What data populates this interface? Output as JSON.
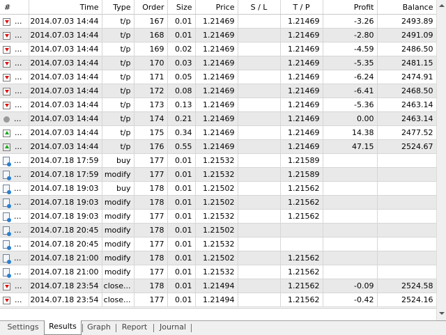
{
  "columns": {
    "hash": "#",
    "time": "Time",
    "type": "Type",
    "order": "Order",
    "size": "Size",
    "price": "Price",
    "sl": "S / L",
    "tp": "T / P",
    "profit": "Profit",
    "balance": "Balance"
  },
  "rows": [
    {
      "icon": "red-down-arrow-icon",
      "time": "2014.07.03 14:44",
      "type": "t/p",
      "order": "167",
      "size": "0.01",
      "price": "1.21469",
      "sl": "",
      "tp": "1.21469",
      "profit": "-3.26",
      "balance": "2493.89"
    },
    {
      "icon": "red-down-arrow-icon",
      "time": "2014.07.03 14:44",
      "type": "t/p",
      "order": "168",
      "size": "0.01",
      "price": "1.21469",
      "sl": "",
      "tp": "1.21469",
      "profit": "-2.80",
      "balance": "2491.09"
    },
    {
      "icon": "red-down-arrow-icon",
      "time": "2014.07.03 14:44",
      "type": "t/p",
      "order": "169",
      "size": "0.02",
      "price": "1.21469",
      "sl": "",
      "tp": "1.21469",
      "profit": "-4.59",
      "balance": "2486.50"
    },
    {
      "icon": "red-down-arrow-icon",
      "time": "2014.07.03 14:44",
      "type": "t/p",
      "order": "170",
      "size": "0.03",
      "price": "1.21469",
      "sl": "",
      "tp": "1.21469",
      "profit": "-5.35",
      "balance": "2481.15"
    },
    {
      "icon": "red-down-arrow-icon",
      "time": "2014.07.03 14:44",
      "type": "t/p",
      "order": "171",
      "size": "0.05",
      "price": "1.21469",
      "sl": "",
      "tp": "1.21469",
      "profit": "-6.24",
      "balance": "2474.91"
    },
    {
      "icon": "red-down-arrow-icon",
      "time": "2014.07.03 14:44",
      "type": "t/p",
      "order": "172",
      "size": "0.08",
      "price": "1.21469",
      "sl": "",
      "tp": "1.21469",
      "profit": "-6.41",
      "balance": "2468.50"
    },
    {
      "icon": "red-down-arrow-icon",
      "time": "2014.07.03 14:44",
      "type": "t/p",
      "order": "173",
      "size": "0.13",
      "price": "1.21469",
      "sl": "",
      "tp": "1.21469",
      "profit": "-5.36",
      "balance": "2463.14"
    },
    {
      "icon": "grey-dot-icon",
      "time": "2014.07.03 14:44",
      "type": "t/p",
      "order": "174",
      "size": "0.21",
      "price": "1.21469",
      "sl": "",
      "tp": "1.21469",
      "profit": "0.00",
      "balance": "2463.14"
    },
    {
      "icon": "green-up-arrow-icon",
      "time": "2014.07.03 14:44",
      "type": "t/p",
      "order": "175",
      "size": "0.34",
      "price": "1.21469",
      "sl": "",
      "tp": "1.21469",
      "profit": "14.38",
      "balance": "2477.52"
    },
    {
      "icon": "green-up-arrow-icon",
      "time": "2014.07.03 14:44",
      "type": "t/p",
      "order": "176",
      "size": "0.55",
      "price": "1.21469",
      "sl": "",
      "tp": "1.21469",
      "profit": "47.15",
      "balance": "2524.67"
    },
    {
      "icon": "order-document-icon",
      "time": "2014.07.18 17:59",
      "type": "buy",
      "order": "177",
      "size": "0.01",
      "price": "1.21532",
      "sl": "",
      "tp": "1.21589",
      "profit": "",
      "balance": ""
    },
    {
      "icon": "order-document-icon",
      "time": "2014.07.18 17:59",
      "type": "modify",
      "order": "177",
      "size": "0.01",
      "price": "1.21532",
      "sl": "",
      "tp": "1.21589",
      "profit": "",
      "balance": ""
    },
    {
      "icon": "order-document-icon",
      "time": "2014.07.18 19:03",
      "type": "buy",
      "order": "178",
      "size": "0.01",
      "price": "1.21502",
      "sl": "",
      "tp": "1.21562",
      "profit": "",
      "balance": ""
    },
    {
      "icon": "order-document-icon",
      "time": "2014.07.18 19:03",
      "type": "modify",
      "order": "178",
      "size": "0.01",
      "price": "1.21502",
      "sl": "",
      "tp": "1.21562",
      "profit": "",
      "balance": ""
    },
    {
      "icon": "order-document-icon",
      "time": "2014.07.18 19:03",
      "type": "modify",
      "order": "177",
      "size": "0.01",
      "price": "1.21532",
      "sl": "",
      "tp": "1.21562",
      "profit": "",
      "balance": ""
    },
    {
      "icon": "order-document-icon",
      "time": "2014.07.18 20:45",
      "type": "modify",
      "order": "178",
      "size": "0.01",
      "price": "1.21502",
      "sl": "",
      "tp": "",
      "profit": "",
      "balance": ""
    },
    {
      "icon": "order-document-icon",
      "time": "2014.07.18 20:45",
      "type": "modify",
      "order": "177",
      "size": "0.01",
      "price": "1.21532",
      "sl": "",
      "tp": "",
      "profit": "",
      "balance": ""
    },
    {
      "icon": "order-document-icon",
      "time": "2014.07.18 21:00",
      "type": "modify",
      "order": "178",
      "size": "0.01",
      "price": "1.21502",
      "sl": "",
      "tp": "1.21562",
      "profit": "",
      "balance": ""
    },
    {
      "icon": "order-document-icon",
      "time": "2014.07.18 21:00",
      "type": "modify",
      "order": "177",
      "size": "0.01",
      "price": "1.21532",
      "sl": "",
      "tp": "1.21562",
      "profit": "",
      "balance": ""
    },
    {
      "icon": "red-down-arrow-icon",
      "time": "2014.07.18 23:54",
      "type": "close...",
      "order": "178",
      "size": "0.01",
      "price": "1.21494",
      "sl": "",
      "tp": "1.21562",
      "profit": "-0.09",
      "balance": "2524.58"
    },
    {
      "icon": "red-down-arrow-icon",
      "time": "2014.07.18 23:54",
      "type": "close...",
      "order": "177",
      "size": "0.01",
      "price": "1.21494",
      "sl": "",
      "tp": "1.21562",
      "profit": "-0.42",
      "balance": "2524.16"
    }
  ],
  "row_dots": "...",
  "tabs": [
    {
      "label": "Settings",
      "active": false
    },
    {
      "label": "Results",
      "active": true
    },
    {
      "label": "Graph",
      "active": false
    },
    {
      "label": "Report",
      "active": false
    },
    {
      "label": "Journal",
      "active": false
    }
  ],
  "colors": {
    "row_alt": "#e9e9e9",
    "grid_line": "#d6d6d6",
    "loss_arrow": "#d11",
    "profit_arrow": "#1a1"
  }
}
